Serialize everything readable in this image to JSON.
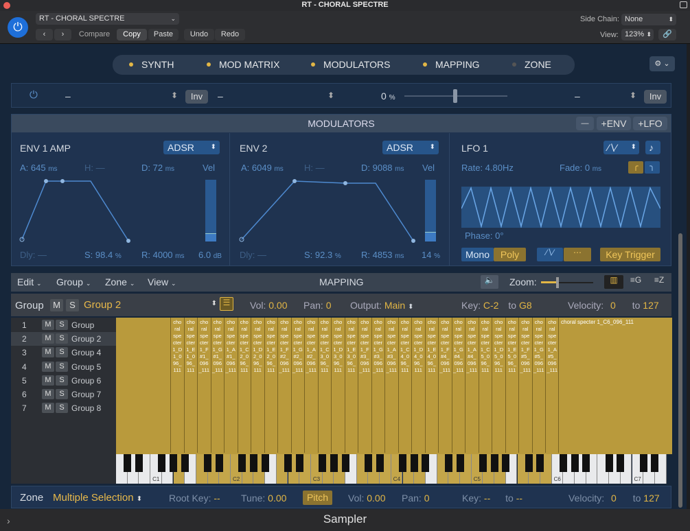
{
  "window": {
    "title": "RT - CHORAL SPECTRE"
  },
  "header": {
    "preset": "RT - CHORAL SPECTRE",
    "compare": "Compare",
    "copy": "Copy",
    "paste": "Paste",
    "undo": "Undo",
    "redo": "Redo",
    "sidechain_label": "Side Chain:",
    "sidechain_value": "None",
    "view_label": "View:",
    "view_value": "123%"
  },
  "tabs": [
    {
      "label": "SYNTH",
      "active": true
    },
    {
      "label": "MOD MATRIX",
      "active": true
    },
    {
      "label": "MODULATORS",
      "active": true
    },
    {
      "label": "MAPPING",
      "active": true
    },
    {
      "label": "ZONE",
      "active": false
    }
  ],
  "matrix_row": {
    "source": "–",
    "inv": "Inv",
    "dest": "–",
    "amount": "0",
    "amount_unit": "%",
    "via": "–",
    "inv2": "Inv"
  },
  "modulators": {
    "title": "MODULATORS",
    "minus": "—",
    "env_btn": "ENV",
    "lfo_btn": "LFO"
  },
  "env1": {
    "title": "ENV 1 AMP",
    "mode": "ADSR",
    "a": "A: 645",
    "a_unit": "ms",
    "h": "H: —",
    "d": "D: 72",
    "d_unit": "ms",
    "vel": "Vel",
    "dly": "Dly: —",
    "s": "S: 98.4",
    "s_unit": "%",
    "r": "R: 4000",
    "r_unit": "ms",
    "vel_val": "6.0",
    "vel_unit": "dB"
  },
  "env2": {
    "title": "ENV 2",
    "mode": "ADSR",
    "a": "A: 6049",
    "a_unit": "ms",
    "h": "H: —",
    "d": "D: 9088",
    "d_unit": "ms",
    "vel": "Vel",
    "dly": "Dly: —",
    "s": "S: 92.3",
    "s_unit": "%",
    "r": "R: 4853",
    "r_unit": "ms",
    "vel_val": "14",
    "vel_unit": "%"
  },
  "lfo1": {
    "title": "LFO 1",
    "rate": "Rate: 4.80Hz",
    "fade": "Fade: 0",
    "fade_unit": "ms",
    "phase": "Phase: 0°",
    "mono": "Mono",
    "poly": "Poly",
    "key_trigger": "Key Trigger"
  },
  "mapping": {
    "edit": "Edit",
    "group": "Group",
    "zone": "Zone",
    "view": "View",
    "title": "MAPPING",
    "zoom": "Zoom:"
  },
  "group_bar": {
    "label": "Group",
    "m": "M",
    "s": "S",
    "name": "Group 2",
    "vol_label": "Vol:",
    "vol": "0.00",
    "pan_label": "Pan:",
    "pan": "0",
    "output_label": "Output:",
    "output": "Main",
    "key_label": "Key:",
    "key_from": "C-2",
    "to": "to",
    "key_to": "G8",
    "vel_label": "Velocity:",
    "vel_from": "0",
    "vel_to": "127"
  },
  "groups": [
    {
      "num": "1",
      "name": "Group"
    },
    {
      "num": "2",
      "name": "Group 2"
    },
    {
      "num": "3",
      "name": "Group 4"
    },
    {
      "num": "4",
      "name": "Group 5"
    },
    {
      "num": "5",
      "name": "Group 6"
    },
    {
      "num": "6",
      "name": "Group 7"
    },
    {
      "num": "7",
      "name": "Group 8"
    }
  ],
  "zones": [
    "cho ral spe cter 1_D 1_0 96_ 111",
    "cho ral spe cter 1_E 1_0 96_ 111",
    "cho ral spe cter 1_F #1_ 096 _111",
    "cho ral spe cter 1_G #1_ 096 _111",
    "cho ral spe cter 1_A #1_ 096 _111",
    "cho ral spe cter 1_C 2_0 96_ 111",
    "cho ral spe cter 1_D 2_0 96_ 111",
    "cho ral spe cter 1_E 2_0 96_ 111",
    "cho ral spe cter 1_F #2_ 096 _111",
    "cho ral spe cter 1_G #2_ 096 _111",
    "cho ral spe cter 1_A #2_ 096 _111",
    "cho ral spe cter 1_C 3_0 96_ 111",
    "cho ral spe cter 1_D 3_0 96_ 111",
    "cho ral spe cter 1_E 3_0 96_ 111",
    "cho ral spe cter 1_F #3_ 096 _111",
    "cho ral spe cter 1_G #3_ 096 _111",
    "cho ral spe cter 1_A #3_ 096 _111",
    "cho ral spe cter 1_C 4_0 96_ 111",
    "cho ral spe cter 1_D 4_0 96_ 111",
    "cho ral spe cter 1_E 4_0 96_ 111",
    "cho ral spe cter 1_F #4_ 096 _111",
    "cho ral spe cter 1_G #4_ 096 _111",
    "cho ral spe cter 1_A #4_ 096 _111",
    "cho ral spe cter 1_C 5_0 96_ 111",
    "cho ral spe cter 1_D 5_0 96_ 111",
    "cho ral spe cter 1_E 5_0 96_ 111",
    "cho ral spe cter 1_F #5_ 096 _111",
    "cho ral spe cter 1_G #5_ 096 _111",
    "cho ral spe cter 1_A #5_ 096 _111"
  ],
  "last_zone": "choral specter 1_C6_096_111",
  "octaves": [
    "C1",
    "C2",
    "C3",
    "C4",
    "C5",
    "C6",
    "C7"
  ],
  "zone_bar": {
    "label": "Zone",
    "value": "Multiple Selection",
    "root_label": "Root Key:",
    "root": "--",
    "tune_label": "Tune:",
    "tune": "0.00",
    "pitch": "Pitch",
    "vol_label": "Vol:",
    "vol": "0.00",
    "pan_label": "Pan:",
    "pan": "0",
    "key_label": "Key:",
    "key_from": "--",
    "to": "to",
    "key_to": "--",
    "vel_label": "Velocity:",
    "vel_from": "0",
    "vel_to": "127"
  },
  "footer": {
    "title": "Sampler"
  }
}
